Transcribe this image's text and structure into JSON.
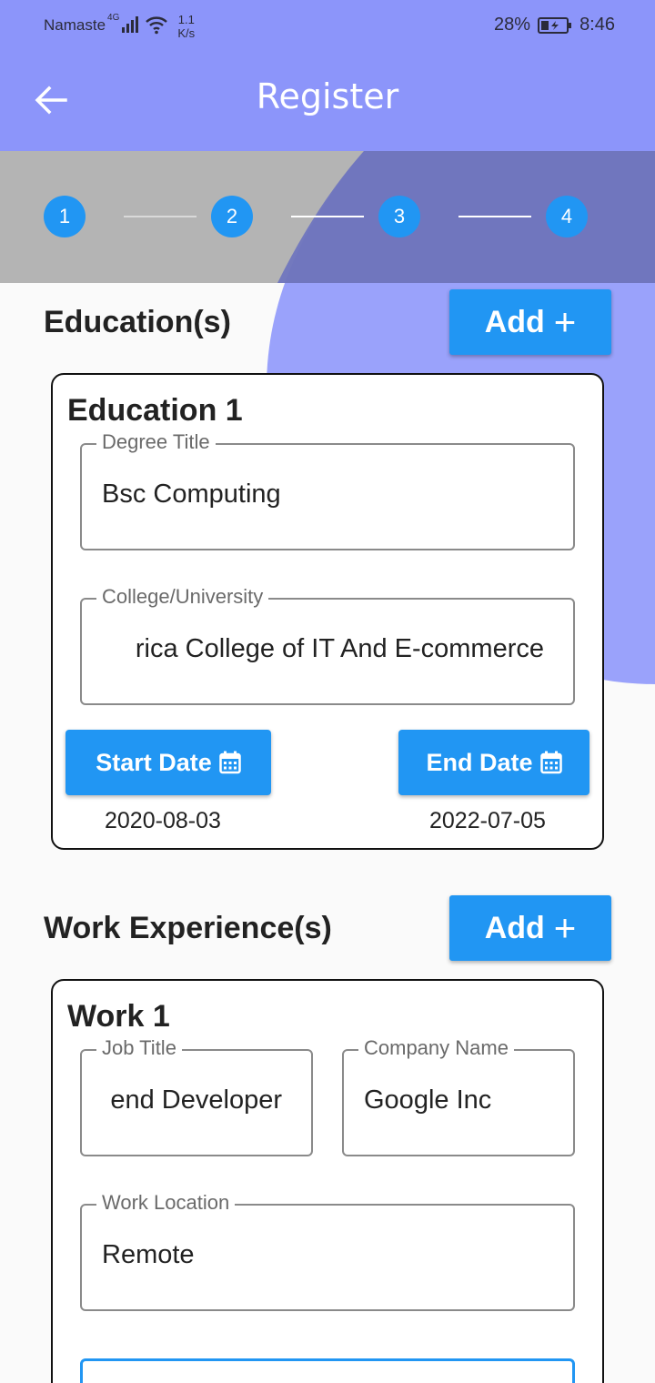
{
  "status_bar": {
    "carrier": "Namaste",
    "network": "4G",
    "speed_value": "1.1",
    "speed_unit": "K/s",
    "battery": "28%",
    "time": "8:46"
  },
  "app_bar": {
    "title": "Register"
  },
  "stepper": {
    "steps": [
      "1",
      "2",
      "3",
      "4"
    ],
    "current_step": 3
  },
  "education": {
    "section_title": "Education(s)",
    "add_label": "Add",
    "card_title": "Education 1",
    "degree_label": "Degree Title",
    "degree_value": "Bsc Computing",
    "college_label": "College/University",
    "college_value": "rica College of IT And E-commerce",
    "start_label": "Start Date",
    "start_value": "2020-08-03",
    "end_label": "End Date",
    "end_value": "2022-07-05"
  },
  "work": {
    "section_title": "Work Experience(s)",
    "add_label": "Add",
    "card_title": "Work 1",
    "job_label": "Job Title",
    "job_value": "end Developer",
    "company_label": "Company Name",
    "company_value": "Google Inc",
    "location_label": "Work Location",
    "location_value": "Remote"
  },
  "colors": {
    "app_bar": "#8c95fa",
    "accent": "#2196f3",
    "blob": "#8c95fa"
  }
}
